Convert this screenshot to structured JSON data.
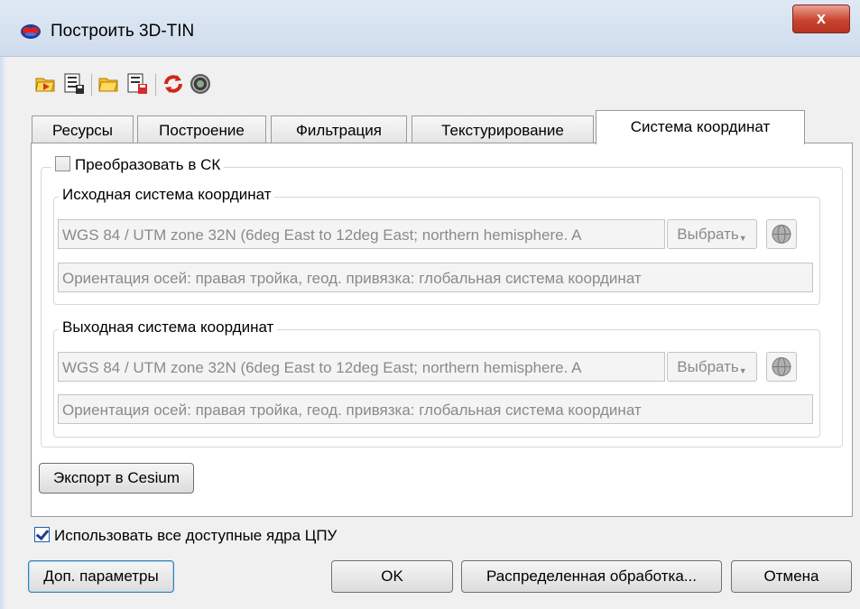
{
  "window": {
    "title": "Построить 3D-TIN",
    "close_label": "x"
  },
  "toolbar": {
    "icons": [
      "open-folder-arrow-icon",
      "save-list-icon",
      "open-folder-icon",
      "save-red-icon",
      "refresh-icon",
      "settings-gear-icon"
    ]
  },
  "tabs": [
    {
      "label": "Ресурсы"
    },
    {
      "label": "Построение"
    },
    {
      "label": "Фильтрация"
    },
    {
      "label": "Текстурирование"
    },
    {
      "label": "Система координат"
    }
  ],
  "active_tab": "Система координат",
  "convert": {
    "label": "Преобразовать в СК",
    "checked": false
  },
  "source_cs": {
    "title": "Исходная система координат",
    "value": "WGS 84 / UTM zone 32N (6deg East to 12deg East; northern hemisphere. A",
    "select_label": "Выбрать",
    "orientation": "Ориентация осей: правая тройка, геод. привязка: глобальная система координат"
  },
  "output_cs": {
    "title": "Выходная система координат",
    "value": "WGS 84 / UTM zone 32N (6deg East to 12deg East; northern hemisphere. A",
    "select_label": "Выбрать",
    "orientation": "Ориентация осей: правая тройка, геод. привязка: глобальная система координат"
  },
  "export_label": "Экспорт в Cesium",
  "use_all_cores": {
    "label": "Использовать все доступные ядра ЦПУ",
    "checked": true
  },
  "buttons": {
    "extra_params": "Доп. параметры",
    "ok": "OK",
    "distributed": "Распределенная обработка...",
    "cancel": "Отмена"
  },
  "colors": {
    "close_button": "#c9442f",
    "titlebar": "#cfdcec",
    "focus_border": "#3c7fb1"
  }
}
